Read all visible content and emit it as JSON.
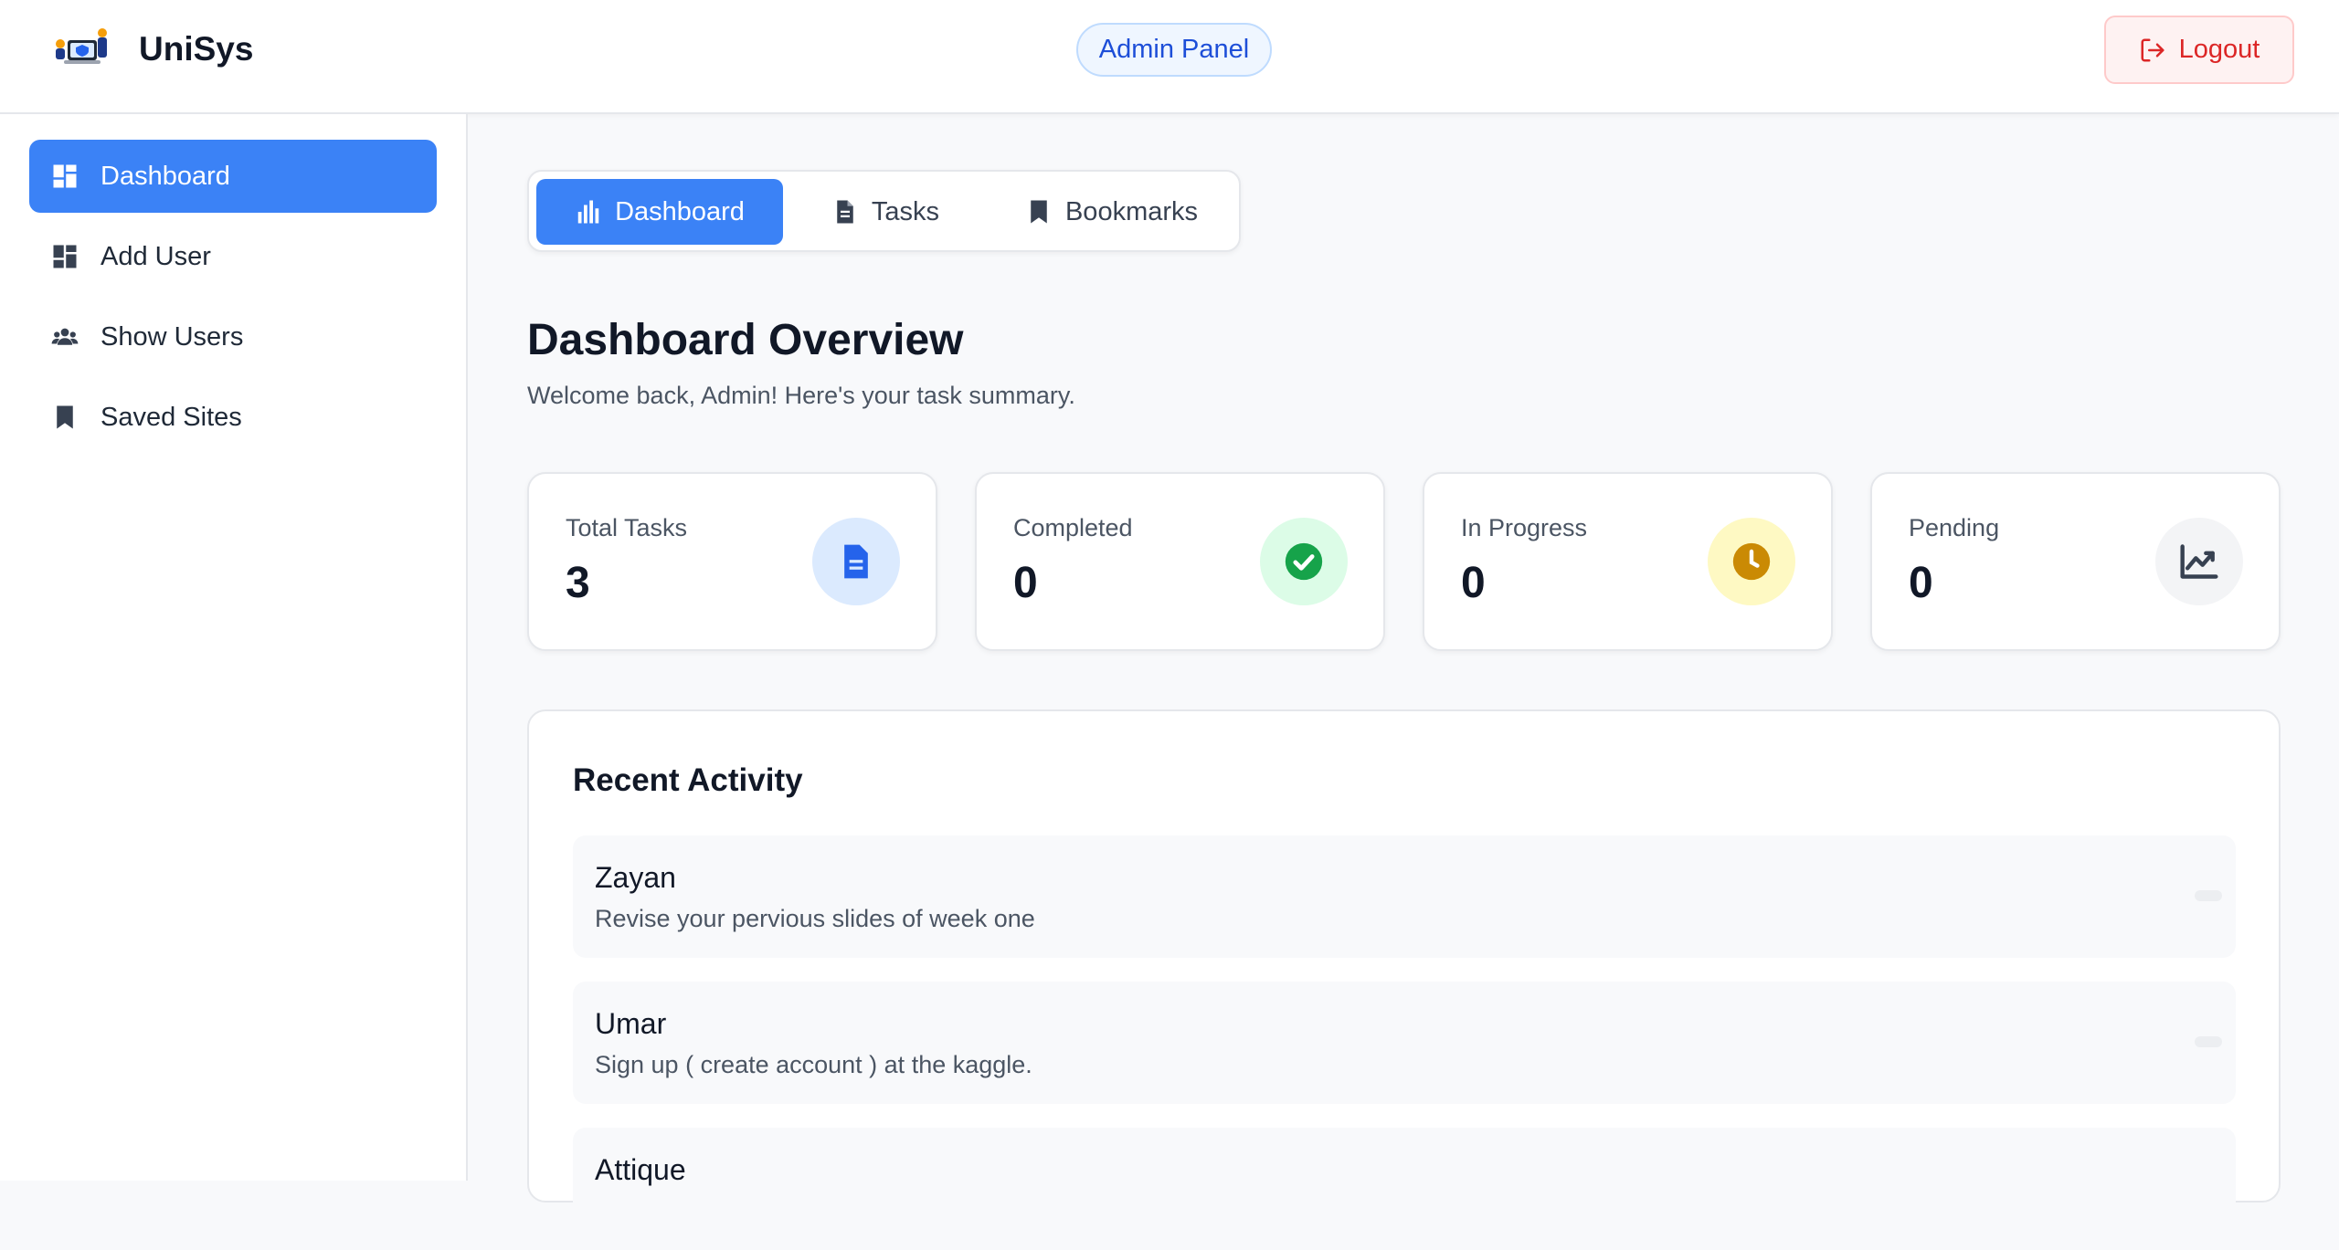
{
  "brand": {
    "name": "UniSys"
  },
  "header": {
    "role_badge": "Admin Panel",
    "logout_label": "Logout"
  },
  "sidebar": {
    "items": [
      {
        "label": "Dashboard",
        "icon": "dashboard-grid-icon",
        "active": true
      },
      {
        "label": "Add User",
        "icon": "dashboard-grid-icon",
        "active": false
      },
      {
        "label": "Show Users",
        "icon": "users-group-icon",
        "active": false
      },
      {
        "label": "Saved Sites",
        "icon": "bookmark-icon",
        "active": false
      }
    ]
  },
  "tabs": [
    {
      "label": "Dashboard",
      "icon": "bar-chart-icon",
      "active": true
    },
    {
      "label": "Tasks",
      "icon": "document-icon",
      "active": false
    },
    {
      "label": "Bookmarks",
      "icon": "bookmark-icon",
      "active": false
    }
  ],
  "main": {
    "title": "Dashboard Overview",
    "subtitle": "Welcome back, Admin! Here's your task summary."
  },
  "stats": [
    {
      "label": "Total Tasks",
      "value": "3",
      "icon": "document-icon",
      "icon_bg": "#dbeafe",
      "icon_color": "#2563eb"
    },
    {
      "label": "Completed",
      "value": "0",
      "icon": "check-circle-icon",
      "icon_bg": "#dcfce7",
      "icon_color": "#16a34a"
    },
    {
      "label": "In Progress",
      "value": "0",
      "icon": "clock-icon",
      "icon_bg": "#fef9c3",
      "icon_color": "#ca8a04"
    },
    {
      "label": "Pending",
      "value": "0",
      "icon": "trending-chart-icon",
      "icon_bg": "#f3f4f6",
      "icon_color": "#374151"
    }
  ],
  "activity": {
    "title": "Recent Activity",
    "items": [
      {
        "name": "Zayan",
        "description": "Revise your pervious slides of week one"
      },
      {
        "name": "Umar",
        "description": "Sign up ( create account ) at the kaggle."
      },
      {
        "name": "Attique",
        "description": ""
      }
    ]
  },
  "colors": {
    "accent": "#3b82f6",
    "danger": "#dc2626",
    "admin_badge": "#1d4ed8"
  }
}
